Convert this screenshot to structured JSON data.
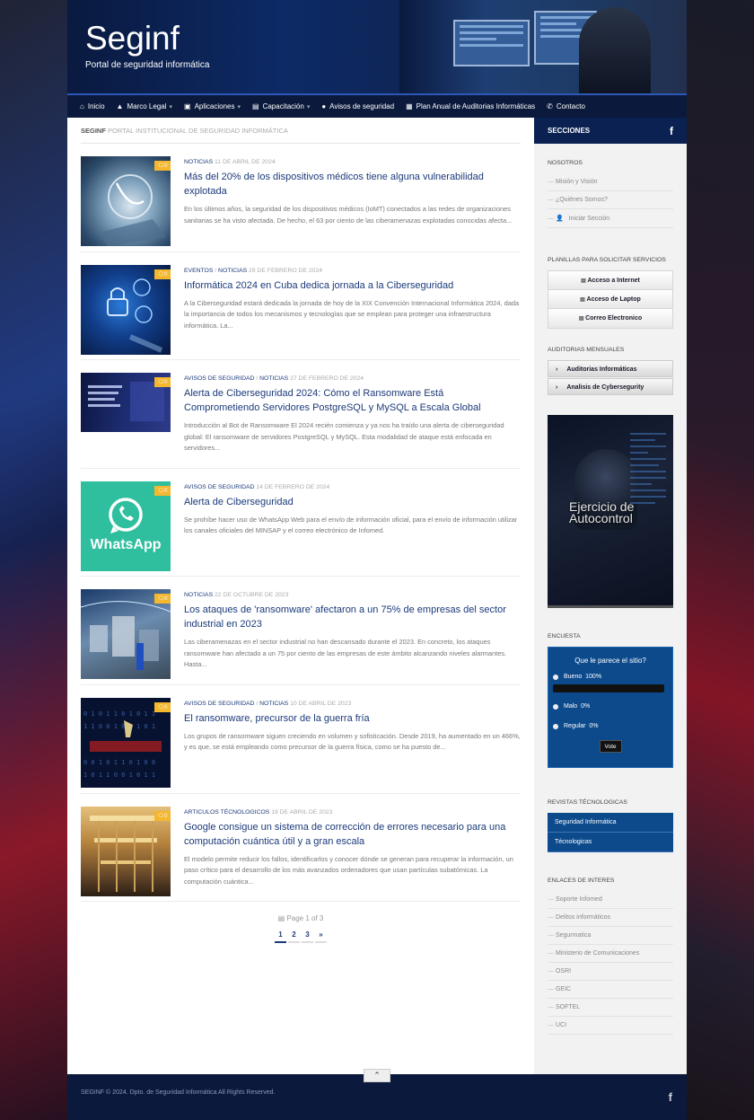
{
  "site": {
    "title": "Seginf",
    "tagline": "Portal de seguridad informática"
  },
  "nav": [
    {
      "label": "Inicio",
      "icon": "home-icon",
      "caret": false
    },
    {
      "label": "Marco Legal",
      "icon": "graduation-cap-icon",
      "caret": true
    },
    {
      "label": "Aplicaciones",
      "icon": "briefcase-icon",
      "caret": true
    },
    {
      "label": "Capacitación",
      "icon": "book-icon",
      "caret": true
    },
    {
      "label": "Avisos de seguridad",
      "icon": "info-icon",
      "caret": false
    },
    {
      "label": "Plan Anual de Auditorias Informáticas",
      "icon": "calendar-icon",
      "caret": false
    },
    {
      "label": "Contacto",
      "icon": "phone-icon",
      "caret": false
    }
  ],
  "breadcrumb": {
    "site": "SEGINF",
    "page": "PORTAL INSTITUCIONAL DE SEGURIDAD INFORMÁTICA"
  },
  "posts": [
    {
      "categories": [
        "NOTICIAS"
      ],
      "date": "11 DE ABRIL DE 2024",
      "title": "Más del 20% de los dispositivos médicos tiene alguna vulnerabilidad explotada",
      "excerpt": "En los últimos años, la seguridad de los dispositivos médicos (IoMT) conectados a las redes de organizaciones sanitarias se ha visto afectada. De hecho, el 63 por ciento de las ciberamenazas explotadas conocidas afecta...",
      "comments": "0"
    },
    {
      "categories": [
        "EVENTOS",
        "NOTICIAS"
      ],
      "date": "29 DE FEBRERO DE 2024",
      "title": "Informática 2024 en Cuba dedica jornada a la Ciberseguridad",
      "excerpt": "A la Ciberseguridad estará dedicada la jornada de hoy de la XIX Convención Internacional Informática 2024, dada la importancia de todos los mecanismos y tecnologías que se emplean para proteger una infraestructura informática. La...",
      "comments": "0"
    },
    {
      "categories": [
        "AVISOS DE SEGURIDAD",
        "NOTICIAS"
      ],
      "date": "27 DE FEBRERO DE 2024",
      "title": "Alerta de Ciberseguridad 2024: Cómo el Ransomware Está Comprometiendo Servidores PostgreSQL y MySQL a Escala Global",
      "excerpt": "Introducción al Bot de Ransomware El 2024 recién comienza y ya nos ha traído una alerta de ciberseguridad global: El ransomware de servidores PostgreSQL y MySQL. Esta modalidad de ataque está enfocada en servidores...",
      "comments": "0"
    },
    {
      "categories": [
        "AVISOS DE SEGURIDAD"
      ],
      "date": "14 DE FEBRERO DE 2024",
      "title": "Alerta de Ciberseguridad",
      "excerpt": "Se prohíbe hacer uso de WhatsApp Web para el envío de información oficial, para el envío de información utilizar los canales oficiales del MINSAP y el correo electrónico de Infomed.",
      "comments": "0",
      "thumb_text": "WhatsApp"
    },
    {
      "categories": [
        "NOTICIAS"
      ],
      "date": "22 DE OCTUBRE DE 2023",
      "title": "Los ataques de 'ransomware' afectaron a un 75% de empresas del sector industrial en 2023",
      "excerpt": "Las ciberamenazas en el sector industrial no han descansado durante el 2023. En concreto, los ataques ransomware han afectado a un 75 por ciento de las empresas de este ámbito alcanzando niveles alarmantes. Hasta...",
      "comments": "0"
    },
    {
      "categories": [
        "AVISOS DE SEGURIDAD",
        "NOTICIAS"
      ],
      "date": "10 DE ABRIL DE 2023",
      "title": "El ransomware, precursor de la guerra fría",
      "excerpt": "Los grupos de ransomware siguen creciendo en volumen y sofisticación. Desde 2019, ha aumentado en un 466%, y es que, se está empleando como precursor de la guerra física, como se ha puesto de...",
      "comments": "0"
    },
    {
      "categories": [
        "ARTICULOS TÉCNOLOGICOS"
      ],
      "date": "19 DE ABRIL DE 2023",
      "title": "Google consigue un sistema de corrección de errores necesario para una computación cuántica útil y a gran escala",
      "excerpt": "El modelo permite reducir los fallos, identificarlos y conocer dónde se generan para recuperar la información, un paso crítico para el desarrollo de los más avanzados ordenadores que usan partículas subatómicas. La computación cuántica...",
      "comments": "0"
    }
  ],
  "pagination": {
    "info": "Page 1 of 3",
    "pages": [
      "1",
      "2",
      "3",
      "»"
    ],
    "current": "1"
  },
  "sidebar": {
    "header": "SECCIONES",
    "nosotros": {
      "title": "NOSOTROS",
      "items": [
        "Misión y Visión",
        "¿Quiénes Somos?",
        "Iniciar Sección"
      ]
    },
    "planillas": {
      "title": "PLANILLAS PARA SOLICITAR SERVICIOS",
      "items": [
        "Acceso a Internet",
        "Acceso de Laptop",
        "Correo Electronico"
      ]
    },
    "auditorias": {
      "title": "AUDITORIAS MENSUALES",
      "items": [
        "Auditorias Informáticas",
        "Analisis de Cybersegurity"
      ]
    },
    "promo": {
      "line1": "Ejercicio de",
      "line2": "Autocontrol"
    },
    "encuesta": {
      "title": "ENCUESTA",
      "question": "Que le parece el sitio?",
      "options": [
        {
          "label": "Bueno",
          "percent": "100%",
          "fraction": 1.0
        },
        {
          "label": "Malo",
          "percent": "0%",
          "fraction": 0.0
        },
        {
          "label": "Regular",
          "percent": "0%",
          "fraction": 0.0
        }
      ],
      "vote_label": "Vote"
    },
    "revistas": {
      "title": "REVISTAS TÉCNOLOGICAS",
      "items": [
        "Seguridad Informática",
        "Técnologicas"
      ]
    },
    "enlaces": {
      "title": "ENLACES DE INTERES",
      "items": [
        "Soporte Infomed",
        "Delitos informáticos",
        "Segurmatica",
        "Ministerio de Comunicaciones",
        "OSRI",
        "GEIC",
        "SOFTEL",
        "UCI"
      ]
    }
  },
  "footer": {
    "copyright": "SEGINF © 2024. Dpto. de Seguridad Informática All Rights Reserved."
  },
  "colors": {
    "brand_dark": "#0b1a3c",
    "accent": "#1b3a7a",
    "badge": "#f4b72e"
  }
}
